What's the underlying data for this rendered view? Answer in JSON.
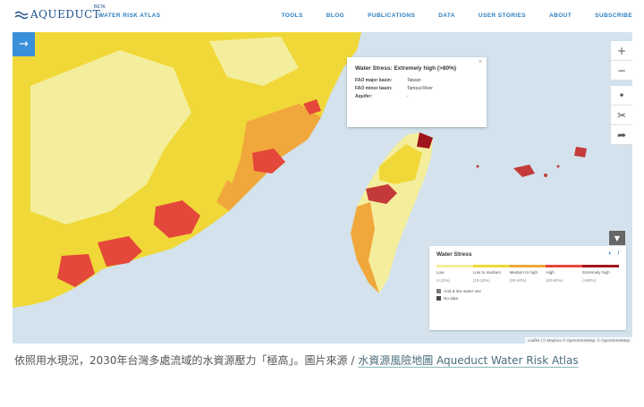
{
  "header": {
    "logo_text": "AQUEDUCT",
    "logo_beta": "BETA",
    "product": "WATER RISK ATLAS",
    "nav": [
      "TOOLS",
      "BLOG",
      "PUBLICATIONS",
      "DATA",
      "USER STORIES",
      "ABOUT",
      "SUBSCRIBE"
    ]
  },
  "map": {
    "menu_icon": "arrow-right-icon",
    "tools": [
      "+",
      "−",
      "•",
      "✂",
      "➦"
    ],
    "popup": {
      "title": "Water Stress: Extremely high (>80%)",
      "close": "×",
      "rows": [
        {
          "key": "FAO major basin:",
          "value": "Taiwan"
        },
        {
          "key": "FAO minor basin:",
          "value": "Tamsui River"
        },
        {
          "key": "Aquifer:",
          "value": "-"
        }
      ]
    },
    "legend": {
      "title": "Water Stress",
      "categories": [
        {
          "label": "Low",
          "range": "(<10%)",
          "color": "#f4ee9c"
        },
        {
          "label": "Low to medium",
          "range": "(10-20%)",
          "color": "#f0d838"
        },
        {
          "label": "Medium to high",
          "range": "(20-40%)",
          "color": "#f0a73b"
        },
        {
          "label": "High",
          "range": "(40-80%)",
          "color": "#e4483a"
        },
        {
          "label": "Extremely high",
          "range": "(>80%)",
          "color": "#a0141e"
        }
      ],
      "extras": [
        "Arid & low water use",
        "No data"
      ]
    },
    "attribution": "Leaflet | © Mapbox © OpenStreetMap, © OpenStreetMap"
  },
  "caption": {
    "text": "依照用水現況，2030年台灣多處流域的水資源壓力「極高」。圖片來源 / ",
    "link": "水資源風險地圖 Aqueduct Water Risk Atlas"
  },
  "colors": {
    "low": "#f4ee9c",
    "low_medium": "#f0d838",
    "medium_high": "#f0a73b",
    "high": "#e4483a",
    "extreme": "#a0141e",
    "sea": "#d3e2ec",
    "brand": "#2b7fc1"
  }
}
